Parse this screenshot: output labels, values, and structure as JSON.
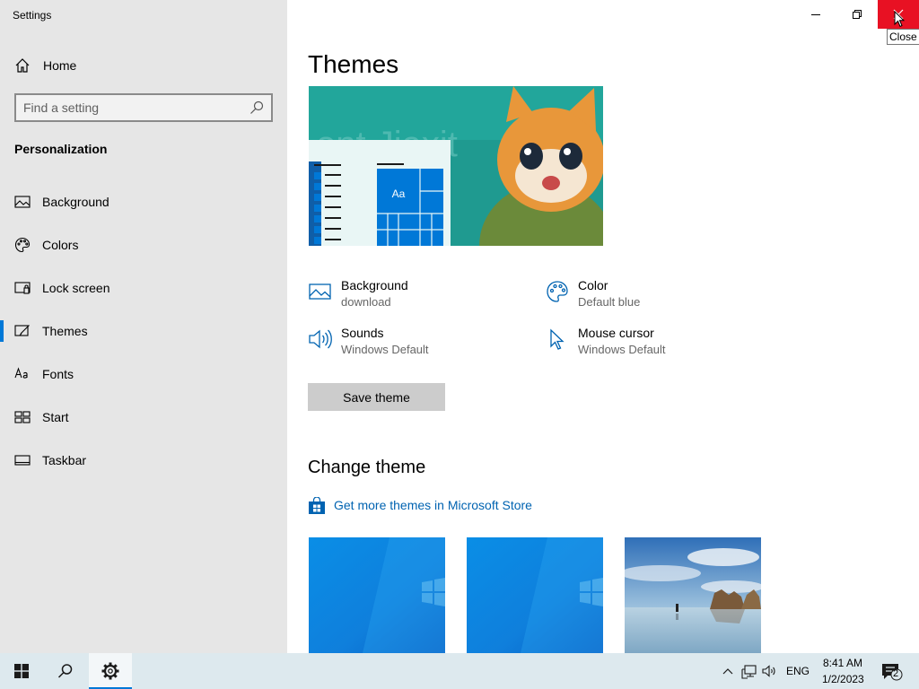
{
  "window": {
    "title": "Settings",
    "tooltip": "Close"
  },
  "sidebar": {
    "home_label": "Home",
    "search_placeholder": "Find a setting",
    "section_title": "Personalization",
    "items": [
      {
        "label": "Background",
        "icon": "picture-icon"
      },
      {
        "label": "Colors",
        "icon": "palette-icon"
      },
      {
        "label": "Lock screen",
        "icon": "lock-screen-icon"
      },
      {
        "label": "Themes",
        "icon": "themes-icon",
        "selected": true
      },
      {
        "label": "Fonts",
        "icon": "fonts-icon"
      },
      {
        "label": "Start",
        "icon": "start-icon"
      },
      {
        "label": "Taskbar",
        "icon": "taskbar-icon"
      }
    ]
  },
  "main": {
    "title": "Themes",
    "preview_tile_label": "Aa",
    "properties": [
      {
        "title": "Background",
        "value": "download",
        "icon": "picture-icon"
      },
      {
        "title": "Color",
        "value": "Default blue",
        "icon": "palette-icon"
      },
      {
        "title": "Sounds",
        "value": "Windows Default",
        "icon": "speaker-icon"
      },
      {
        "title": "Mouse cursor",
        "value": "Windows Default",
        "icon": "cursor-icon"
      }
    ],
    "save_button": "Save theme",
    "change_theme_heading": "Change theme",
    "store_link": "Get more themes in Microsoft Store"
  },
  "taskbar": {
    "language": "ENG",
    "time": "8:41 AM",
    "date": "1/2/2023",
    "notification_count": "2"
  },
  "colors": {
    "accent": "#0078d7",
    "close_red": "#e81123",
    "sidebar_bg": "#e6e6e6",
    "link": "#0063b1"
  }
}
